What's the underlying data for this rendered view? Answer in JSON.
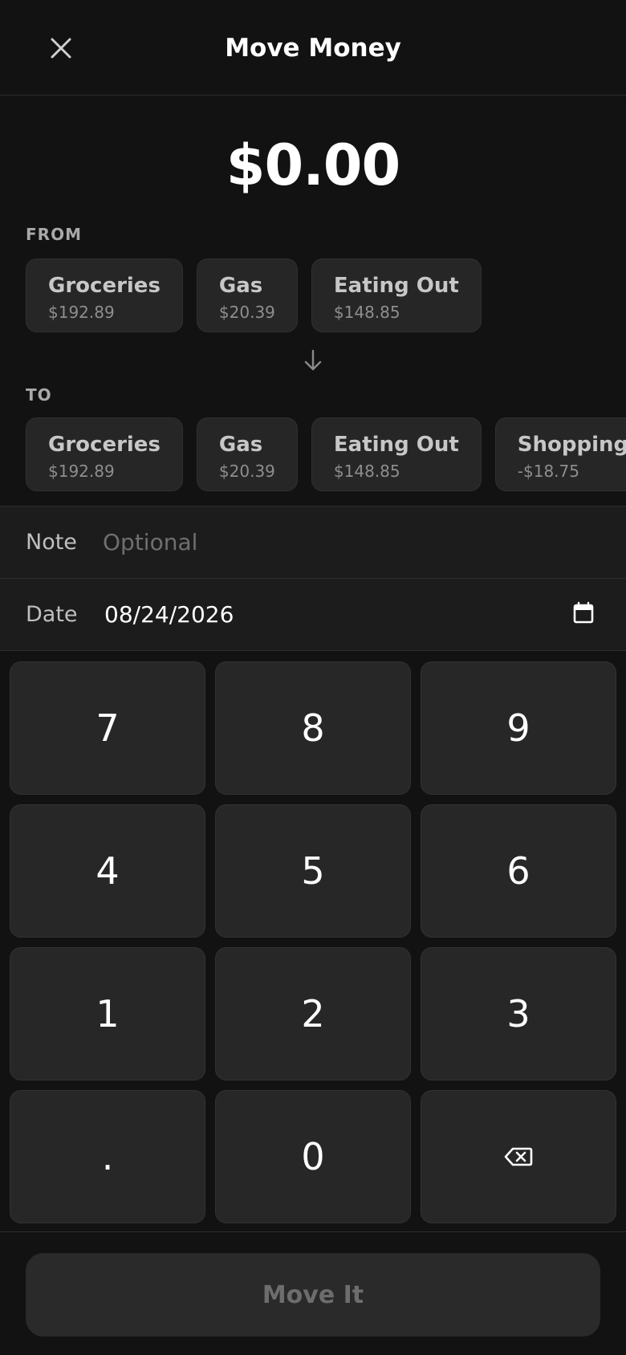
{
  "header": {
    "title": "Move Money",
    "close_icon": "close-icon"
  },
  "amount": "$0.00",
  "from": {
    "label": "FROM",
    "categories": [
      {
        "name": "Groceries",
        "balance": "$192.89"
      },
      {
        "name": "Gas",
        "balance": "$20.39"
      },
      {
        "name": "Eating Out",
        "balance": "$148.85"
      }
    ]
  },
  "arrow_icon": "arrow-down-icon",
  "to": {
    "label": "TO",
    "categories": [
      {
        "name": "Groceries",
        "balance": "$192.89"
      },
      {
        "name": "Gas",
        "balance": "$20.39"
      },
      {
        "name": "Eating Out",
        "balance": "$148.85"
      },
      {
        "name": "Shopping",
        "balance": "-$18.75"
      }
    ]
  },
  "form": {
    "note_label": "Note",
    "note_placeholder": "Optional",
    "note_value": "",
    "date_label": "Date",
    "date_value": "08/24/2026",
    "date_icon": "calendar-icon"
  },
  "keypad": {
    "keys": [
      "7",
      "8",
      "9",
      "4",
      "5",
      "6",
      "1",
      "2",
      "3",
      ".",
      "0"
    ],
    "backspace_icon": "backspace-icon"
  },
  "submit_label": "Move It",
  "colors": {
    "background": "#121212",
    "surface": "#1c1c1c",
    "chip": "#262626",
    "key": "#272727",
    "disabled_text": "#6d6d6d"
  }
}
